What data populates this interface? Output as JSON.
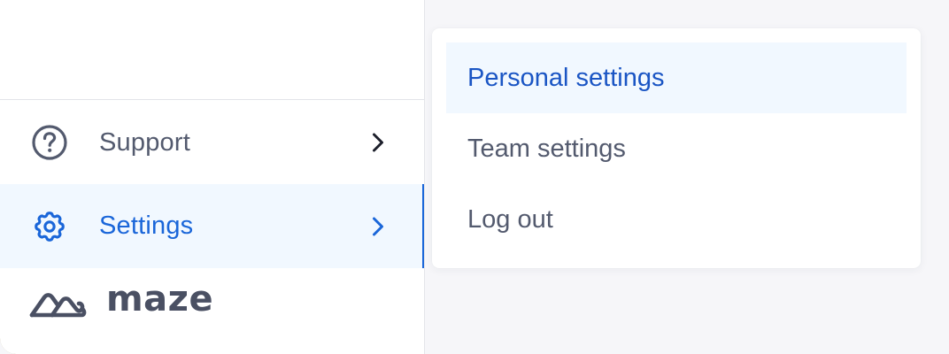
{
  "colors": {
    "accent": "#1a66d9",
    "active_bg": "#f1f8ff",
    "text_muted": "#535a6e",
    "logo_text": "#4a5063"
  },
  "sidebar": {
    "items": [
      {
        "label": "Support",
        "icon": "question-circle-icon",
        "trailing_icon": "chevron-right-icon",
        "active": false
      },
      {
        "label": "Settings",
        "icon": "gear-icon",
        "trailing_icon": "chevron-right-icon",
        "active": true
      }
    ],
    "logo": {
      "text": "maze",
      "icon": "maze-logo-icon"
    }
  },
  "dropdown": {
    "items": [
      {
        "label": "Personal settings",
        "active": true
      },
      {
        "label": "Team settings",
        "active": false
      },
      {
        "label": "Log out",
        "active": false
      }
    ]
  }
}
